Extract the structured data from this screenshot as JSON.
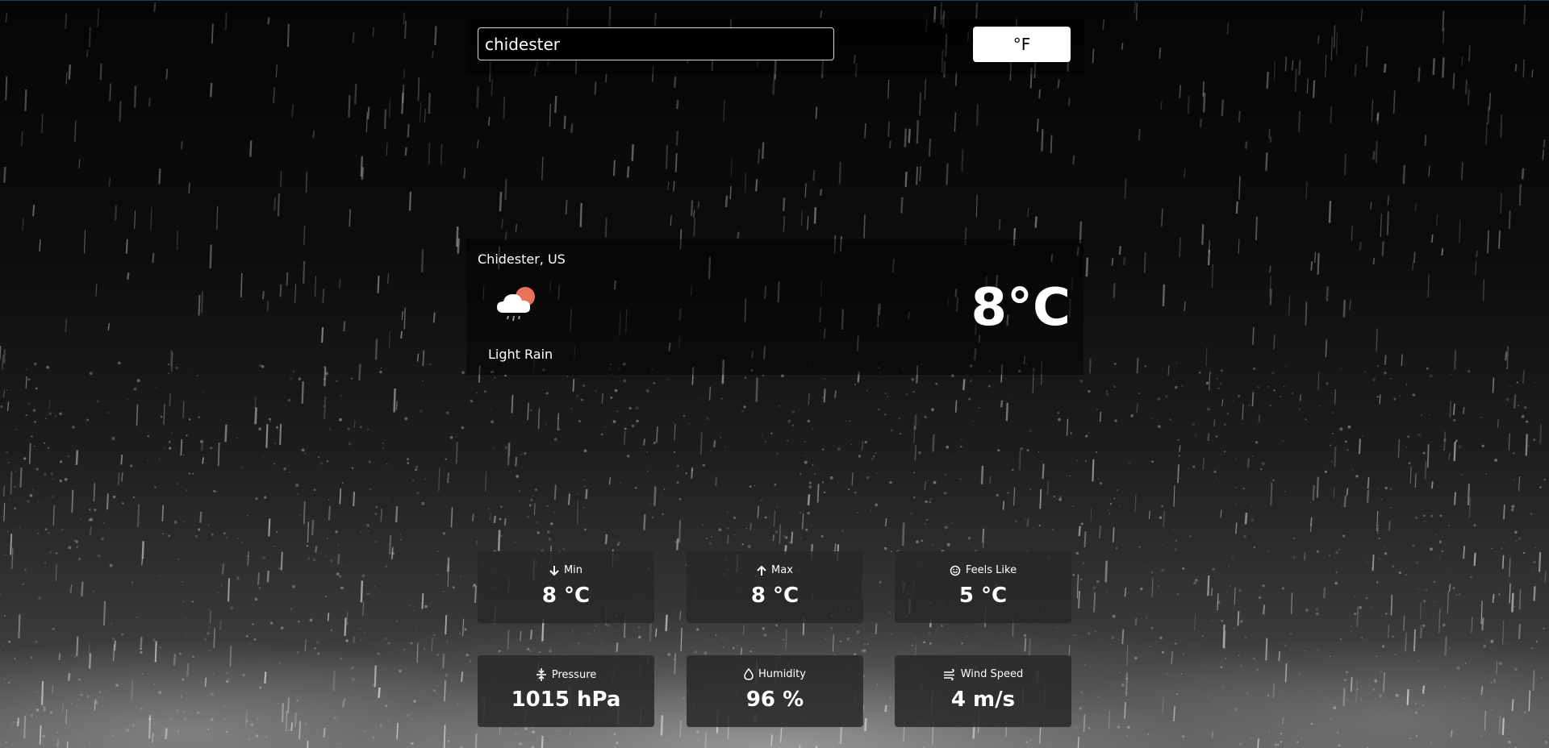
{
  "search": {
    "value": "chidester"
  },
  "unit_toggle": {
    "label": "°F"
  },
  "current": {
    "location": "Chidester, US",
    "icon": "cloud-sun-rain-icon",
    "description": "Light Rain",
    "temperature": "8°C"
  },
  "stats": [
    {
      "label": "Min",
      "value": "8 °C",
      "icon": "arrow-down-icon"
    },
    {
      "label": "Max",
      "value": "8 °C",
      "icon": "arrow-up-icon"
    },
    {
      "label": "Feels Like",
      "value": "5 °C",
      "icon": "smile-icon"
    },
    {
      "label": "Pressure",
      "value": "1015 hPa",
      "icon": "pressure-icon"
    },
    {
      "label": "Humidity",
      "value": "96 %",
      "icon": "droplet-icon"
    },
    {
      "label": "Wind Speed",
      "value": "4 m/s",
      "icon": "wind-icon"
    }
  ],
  "colors": {
    "card_background": "#282828",
    "sun": "#e8735a",
    "button_background": "#ffffff"
  }
}
